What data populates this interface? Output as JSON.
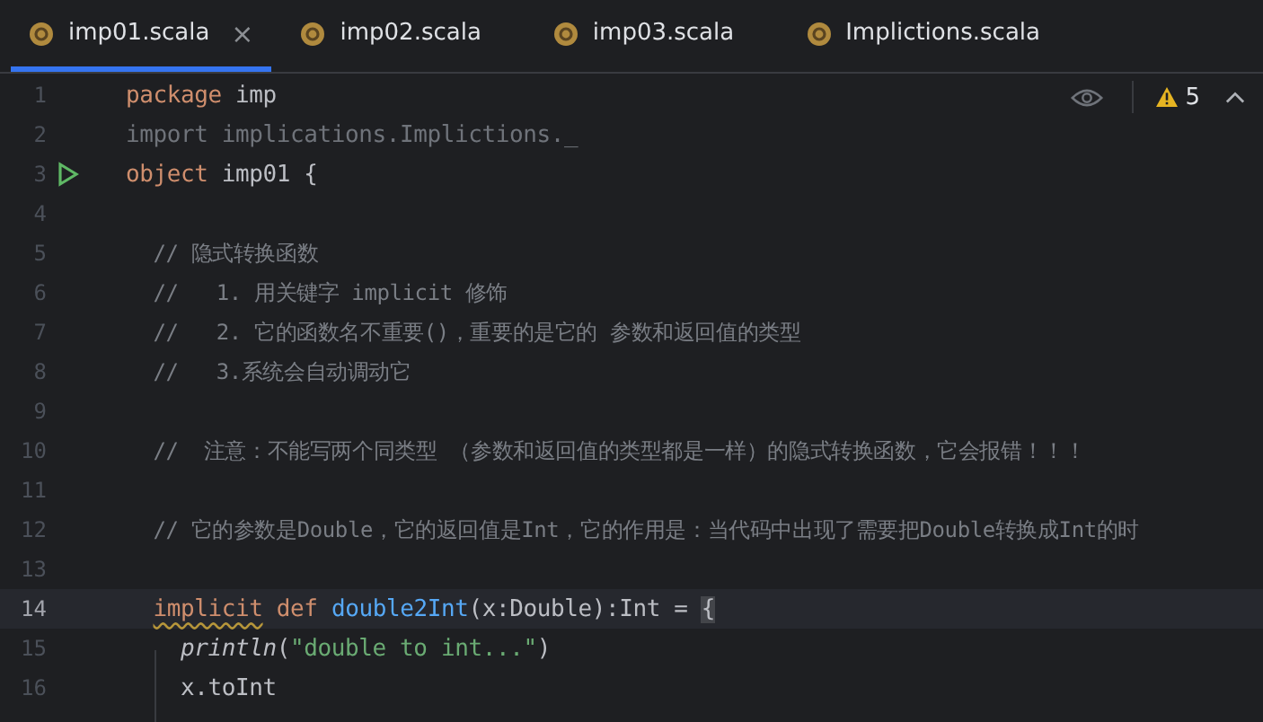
{
  "tabs": [
    {
      "label": "imp01.scala",
      "selected": true,
      "closable": true
    },
    {
      "label": "imp02.scala",
      "selected": false,
      "closable": false
    },
    {
      "label": "imp03.scala",
      "selected": false,
      "closable": false
    },
    {
      "label": "Implictions.scala",
      "selected": false,
      "closable": false
    }
  ],
  "close_glyph": "×",
  "inspections": {
    "warning_count": "5"
  },
  "lines": [
    {
      "number": "1",
      "current": false,
      "runnable": false,
      "tokens": [
        {
          "kind": "keyword",
          "text": "package"
        },
        {
          "kind": "plain",
          "text": " imp"
        }
      ]
    },
    {
      "number": "2",
      "current": false,
      "runnable": false,
      "tokens": [
        {
          "kind": "unused",
          "text": "import implications.Implictions._"
        }
      ]
    },
    {
      "number": "3",
      "current": false,
      "runnable": true,
      "tokens": [
        {
          "kind": "keyword",
          "text": "object"
        },
        {
          "kind": "plain",
          "text": " imp01 {"
        }
      ]
    },
    {
      "number": "4",
      "current": false,
      "runnable": false
    },
    {
      "number": "5",
      "current": false,
      "runnable": false,
      "tokens": [
        {
          "kind": "comment",
          "text": "  // 隐式转换函数"
        }
      ]
    },
    {
      "number": "6",
      "current": false,
      "runnable": false,
      "tokens": [
        {
          "kind": "comment",
          "text": "  //   1. 用关键字 implicit 修饰"
        }
      ]
    },
    {
      "number": "7",
      "current": false,
      "runnable": false,
      "tokens": [
        {
          "kind": "comment",
          "text": "  //   2. 它的函数名不重要()，重要的是它的 参数和返回值的类型"
        }
      ]
    },
    {
      "number": "8",
      "current": false,
      "runnable": false,
      "tokens": [
        {
          "kind": "comment",
          "text": "  //   3.系统会自动调动它"
        }
      ]
    },
    {
      "number": "9",
      "current": false,
      "runnable": false
    },
    {
      "number": "10",
      "current": false,
      "runnable": false,
      "tokens": [
        {
          "kind": "comment",
          "text": "  //  注意：不能写两个同类型 （参数和返回值的类型都是一样）的隐式转换函数，它会报错！！！"
        }
      ]
    },
    {
      "number": "11",
      "current": false,
      "runnable": false
    },
    {
      "number": "12",
      "current": false,
      "runnable": false,
      "tokens": [
        {
          "kind": "comment",
          "text": "  // 它的参数是Double，它的返回值是Int，它的作用是：当代码中出现了需要把Double转换成Int的时"
        }
      ]
    },
    {
      "number": "13",
      "current": false,
      "runnable": false
    },
    {
      "number": "14",
      "current": true,
      "runnable": false,
      "tokens": [
        {
          "kind": "warning",
          "text": "  implicit"
        },
        {
          "kind": "keyword",
          "text": " def"
        },
        {
          "kind": "function",
          "text": " double2Int"
        },
        {
          "kind": "plain",
          "text": "(x:Double):Int = "
        },
        {
          "kind": "brace",
          "text": "{"
        }
      ]
    },
    {
      "number": "15",
      "current": false,
      "runnable": false,
      "tokens": [
        {
          "kind": "call",
          "text": "    println"
        },
        {
          "kind": "plain",
          "text": "("
        },
        {
          "kind": "string",
          "text": "\"double to int...\""
        },
        {
          "kind": "plain",
          "text": ")"
        }
      ]
    },
    {
      "number": "16",
      "current": false,
      "runnable": false,
      "tokens": [
        {
          "kind": "plain",
          "text": "    x.toInt"
        }
      ]
    }
  ]
}
